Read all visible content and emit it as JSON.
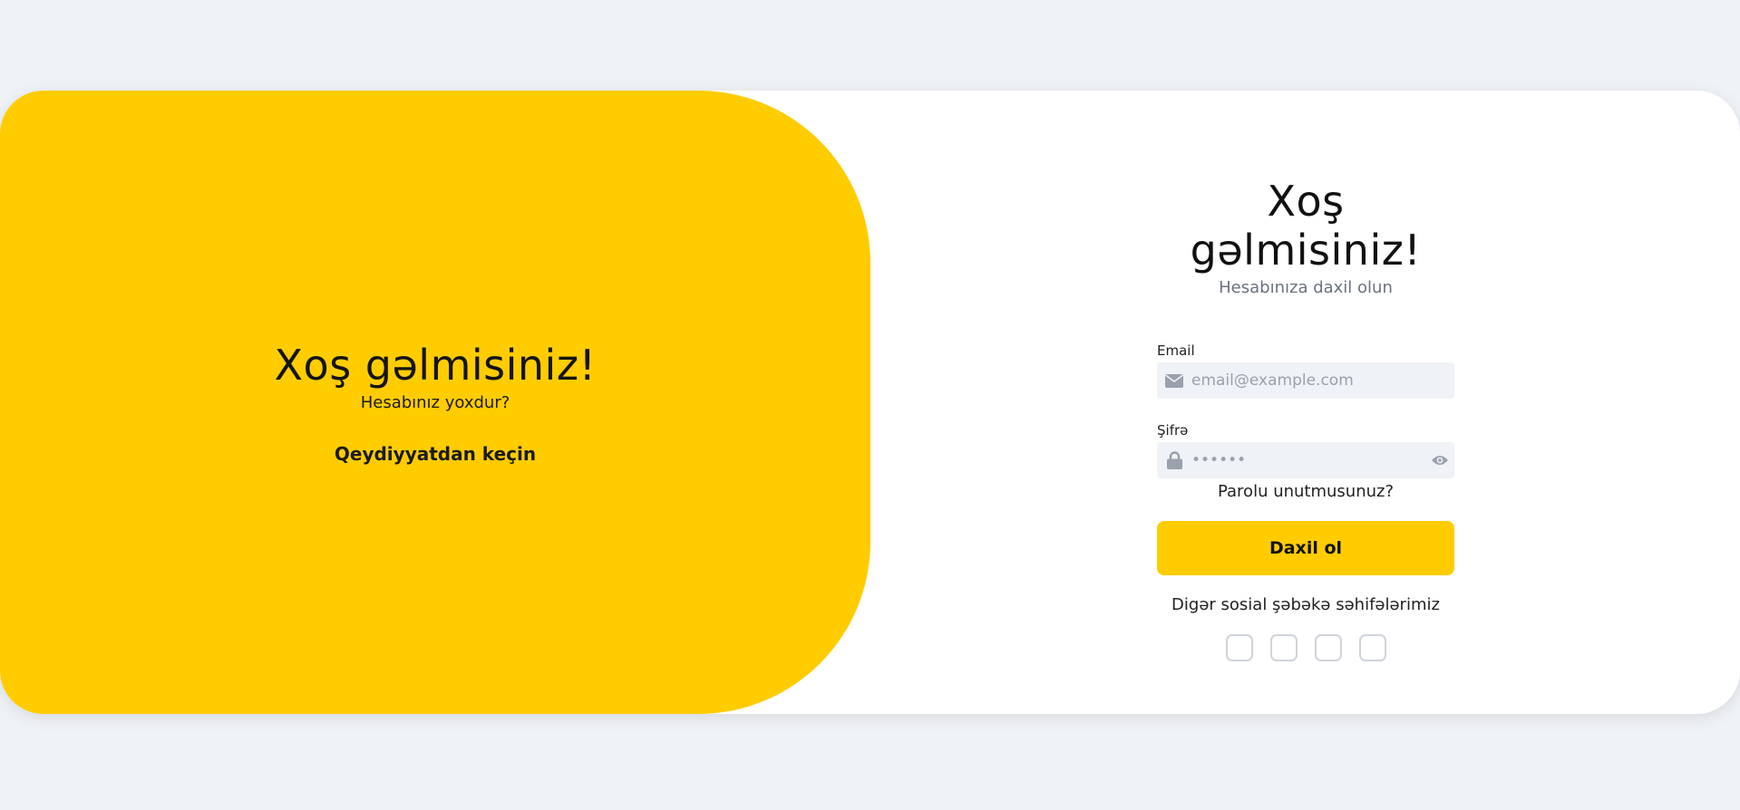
{
  "welcome_panel": {
    "title": "Xoş gəlmisiniz!",
    "subtitle": "Hesabınız yoxdur?",
    "register_link": "Qeydiyyatdan keçin"
  },
  "login_form": {
    "title": "Xoş gəlmisiniz!",
    "subtitle": "Hesabınıza daxil olun",
    "email": {
      "label": "Email",
      "placeholder": "email@example.com",
      "icon": "envelope-icon"
    },
    "password": {
      "label": "Şifrə",
      "placeholder": "••••••",
      "icon": "lock-icon",
      "toggle_icon": "eye-icon"
    },
    "forgot_password": "Parolu unutmusunuz?",
    "submit_label": "Daxil ol",
    "social_title": "Digər sosial şəbəkə səhifələrimiz"
  },
  "colors": {
    "accent": "#ffcc00",
    "background": "#eff2f6",
    "input_bg": "#eff2f6",
    "muted_text": "#6b7280"
  }
}
